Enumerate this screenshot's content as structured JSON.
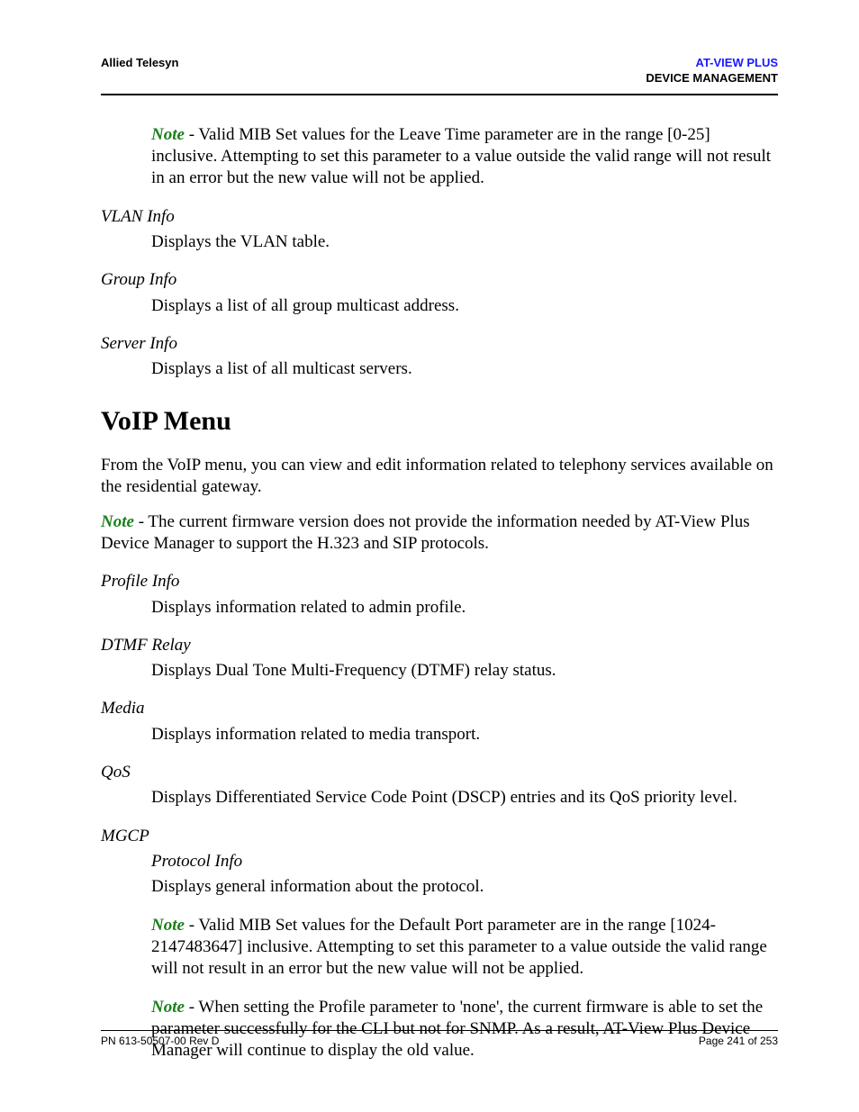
{
  "header": {
    "left": "Allied Telesyn",
    "right_brand": "AT-VIEW PLUS",
    "right_section": "DEVICE MANAGEMENT"
  },
  "top_note": {
    "label": "Note",
    "text": " - Valid MIB Set values for the Leave Time parameter are in the range [0-25] inclusive. Attempting to set this parameter to a value outside the valid range will not result in an error but the new value will not be applied."
  },
  "defs1": [
    {
      "term": "VLAN Info",
      "desc": "Displays the VLAN table."
    },
    {
      "term": "Group Info",
      "desc": "Displays a list of all group multicast address."
    },
    {
      "term": "Server Info",
      "desc": "Displays a list of all multicast servers."
    }
  ],
  "section": {
    "title": "VoIP Menu",
    "intro": "From the VoIP menu, you can view and edit information related to telephony services available on the residential gateway.",
    "note": {
      "label": "Note",
      "text": " - The current firmware version does not provide the information needed by AT-View Plus Device Manager to support the H.323 and SIP protocols."
    }
  },
  "defs2": [
    {
      "term": "Profile Info",
      "desc": "Displays information related to admin profile."
    },
    {
      "term": "DTMF Relay",
      "desc": "Displays Dual Tone Multi-Frequency (DTMF) relay status."
    },
    {
      "term": "Media",
      "desc": "Displays information related to media transport."
    },
    {
      "term": "QoS",
      "desc": "Displays Differentiated Service Code Point (DSCP) entries and its QoS priority level."
    }
  ],
  "mgcp": {
    "term": "MGCP",
    "sub_term": "Protocol Info",
    "sub_desc": "Displays general information about the protocol.",
    "note1": {
      "label": "Note",
      "text": " - Valid MIB Set values for the Default Port parameter are in the range [1024-2147483647] inclusive. Attempting to set this parameter to a value outside the valid range will not result in an error but the new value will not be applied."
    },
    "note2": {
      "label": "Note",
      "text": " - When setting the Profile parameter to 'none', the current firmware is able to set the parameter successfully for the CLI but not for SNMP. As a result, AT-View Plus Device Manager will continue to display the old value."
    }
  },
  "footer": {
    "left": "PN 613-50507-00 Rev D",
    "right": "Page 241 of 253"
  }
}
